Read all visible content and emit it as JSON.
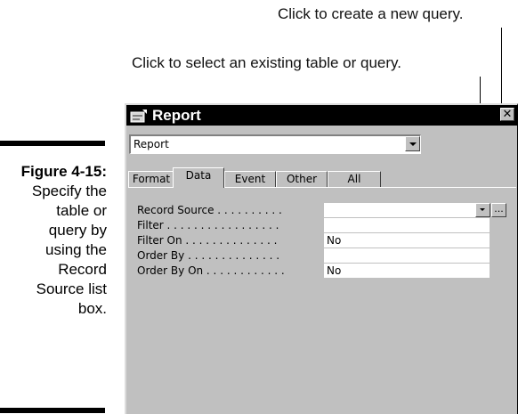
{
  "callouts": {
    "new_query": "Click to create a new query.",
    "existing": "Click to select an existing table or query."
  },
  "caption": {
    "figure": "Figure 4-15:",
    "lines": [
      "Specify the",
      "table or",
      "query by",
      "using the",
      "Record",
      "Source list",
      "box."
    ]
  },
  "window": {
    "title": "Report",
    "close_label": "✕",
    "combo_value": "Report",
    "tabs": [
      "Format",
      "Data",
      "Event",
      "Other",
      "All"
    ],
    "active_tab": "Data",
    "properties": [
      {
        "label": "Record Source . . . . . . . . . .",
        "value": ""
      },
      {
        "label": "Filter . . . . . . . . . . . . . . . . .",
        "value": ""
      },
      {
        "label": "Filter On . . . . . . . . . . . . . .",
        "value": "No"
      },
      {
        "label": "Order By . . . . . . . . . . . . . .",
        "value": ""
      },
      {
        "label": "Order By On . . . . . . . . . . . .",
        "value": "No"
      }
    ],
    "builder_label": "...",
    "icons": {
      "title": "report-window-icon",
      "dropdown": "chevron-down-icon"
    }
  }
}
